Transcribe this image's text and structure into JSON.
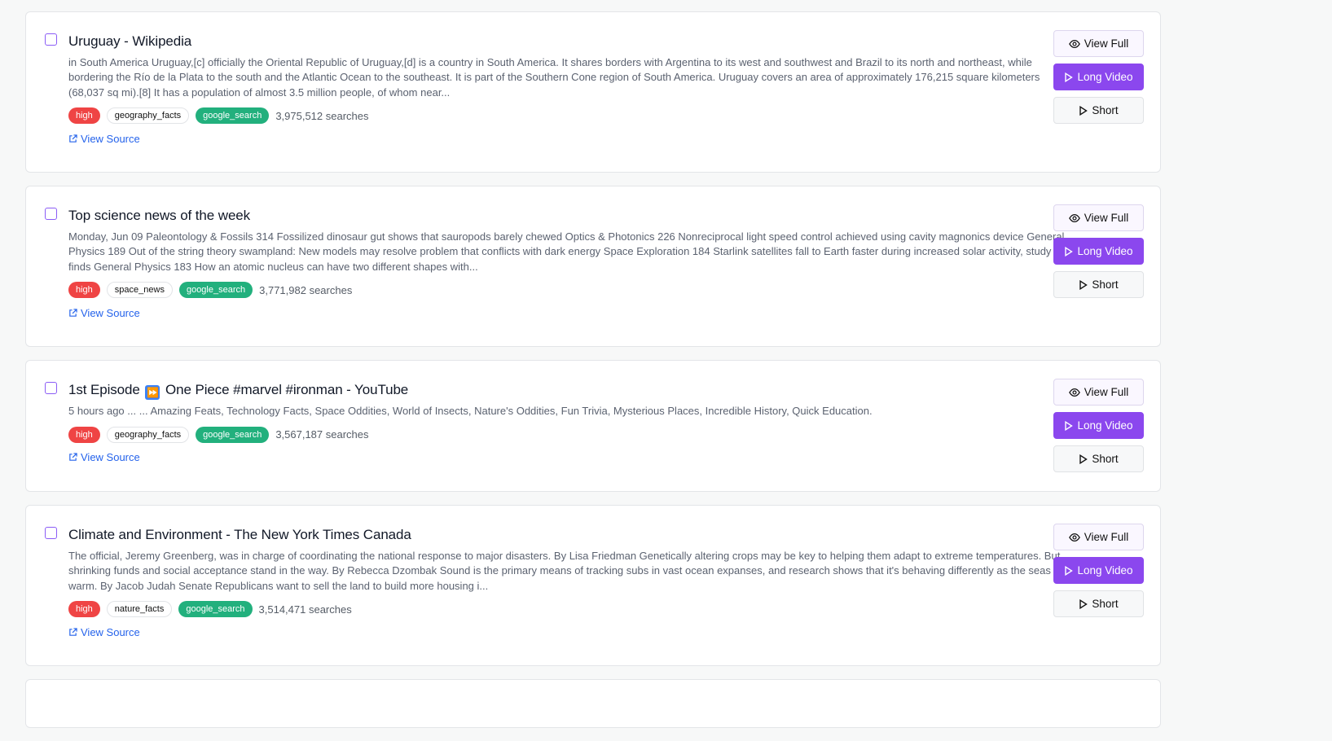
{
  "actions": {
    "view_full_label": "View Full",
    "long_video_label": "Long Video",
    "short_label": "Short"
  },
  "view_source_label": "View Source",
  "colors": {
    "priority_high": "#ef4444",
    "source_badge": "#22b07d",
    "accent_purple": "#8b47ee",
    "link_blue": "#2563eb"
  },
  "results": [
    {
      "title": "Uruguay - Wikipedia",
      "snippet": "in South America Uruguay,[c] officially the Oriental Republic of Uruguay,[d] is a country in South America. It shares borders with Argentina to its west and southwest and Brazil to its north and northeast, while bordering the Río de la Plata to the south and the Atlantic Ocean to the southeast. It is part of the Southern Cone region of South America. Uruguay covers an area of approximately 176,215 square kilometers (68,037 sq mi).[8] It has a population of almost 3.5 million people, of whom near...",
      "priority": "high",
      "category": "geography_facts",
      "source": "google_search",
      "searches": "3,975,512 searches"
    },
    {
      "title": "Top science news of the week",
      "snippet": "Monday, Jun 09 Paleontology & Fossils 314 Fossilized dinosaur gut shows that sauropods barely chewed Optics & Photonics 226 Nonreciprocal light speed control achieved using cavity magnonics device General Physics 189 Out of the string theory swampland: New models may resolve problem that conflicts with dark energy Space Exploration 184 Starlink satellites fall to Earth faster during increased solar activity, study finds General Physics 183 How an atomic nucleus can have two different shapes with...",
      "priority": "high",
      "category": "space_news",
      "source": "google_search",
      "searches": "3,771,982 searches"
    },
    {
      "title_before": "1st Episode",
      "title_emoji": "⏩",
      "title_after": "One Piece #marvel #ironman - YouTube",
      "snippet": "5 hours ago ... ... Amazing Feats, Technology Facts, Space Oddities, World of Insects, Nature's Oddities, Fun Trivia, Mysterious Places, Incredible History, Quick Education.",
      "priority": "high",
      "category": "geography_facts",
      "source": "google_search",
      "searches": "3,567,187 searches"
    },
    {
      "title": "Climate and Environment - The New York Times Canada",
      "snippet": "The official, Jeremy Greenberg, was in charge of coordinating the national response to major disasters. By Lisa Friedman Genetically altering crops may be key to helping them adapt to extreme temperatures. But shrinking funds and social acceptance stand in the way. By Rebecca Dzombak Sound is the primary means of tracking subs in vast ocean expanses, and research shows that it's behaving differently as the seas warm. By Jacob Judah Senate Republicans want to sell the land to build more housing i...",
      "priority": "high",
      "category": "nature_facts",
      "source": "google_search",
      "searches": "3,514,471 searches"
    }
  ]
}
